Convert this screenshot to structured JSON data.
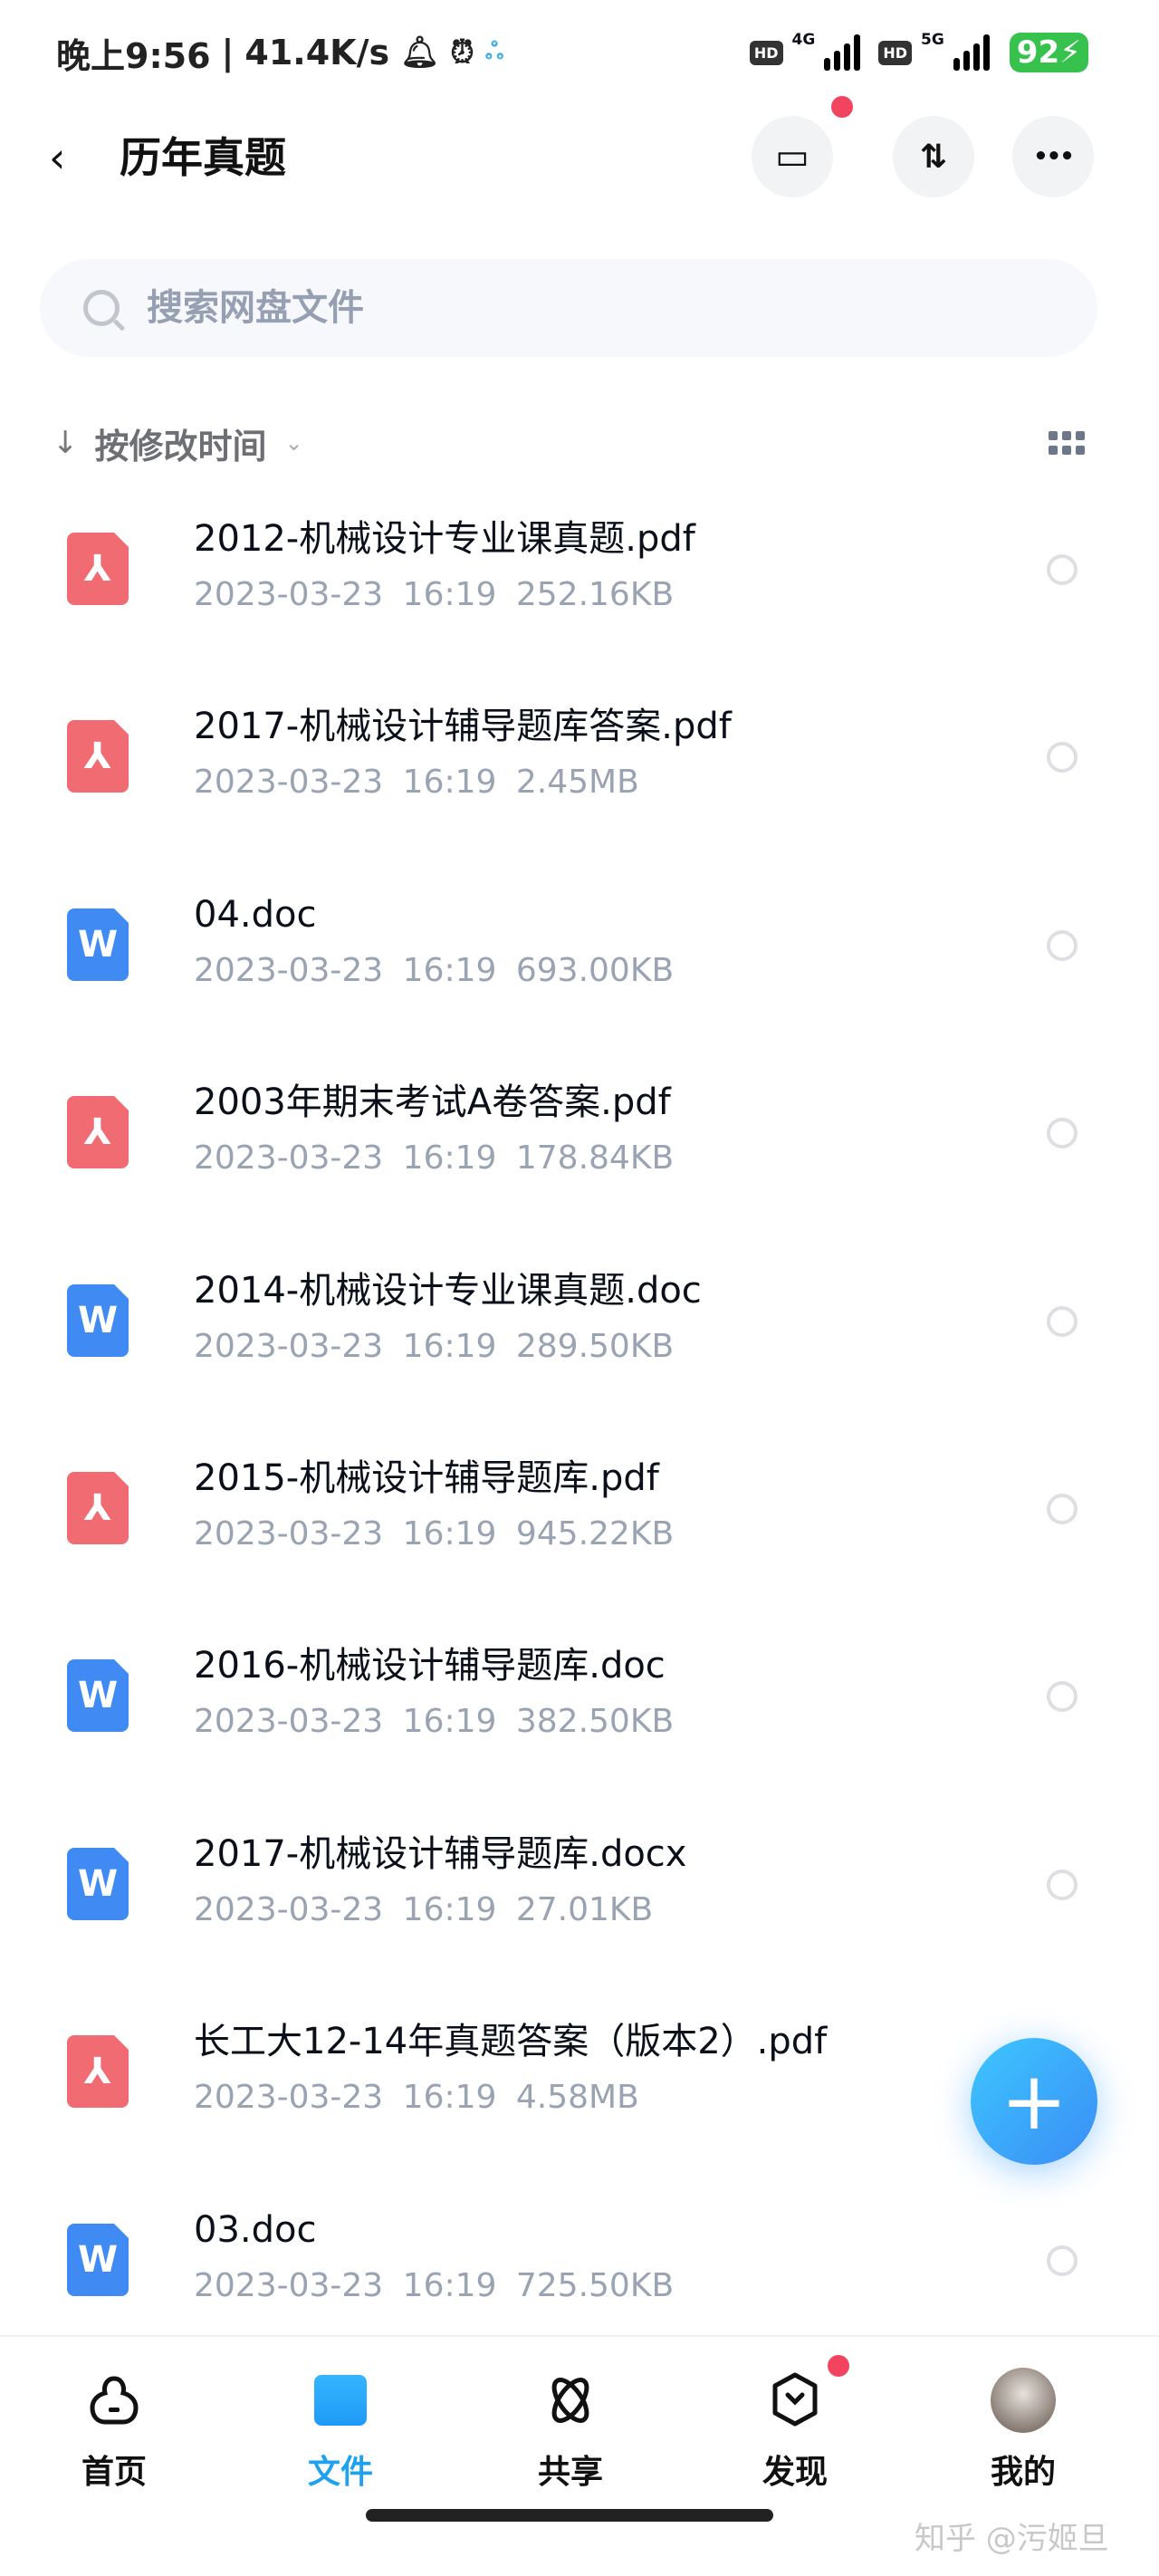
{
  "status_bar": {
    "time": "晚上9:56",
    "net_speed": "41.4K/s",
    "separator": "|",
    "sim1_hd": "HD",
    "sim1_net": "4G",
    "sim2_hd": "HD",
    "sim2_net": "5G",
    "battery": "92",
    "icons": [
      "bell-icon",
      "alarm-icon",
      "baidu-cloud-icon",
      "charging-icon"
    ]
  },
  "header": {
    "title": "历年真题",
    "back_icon": "chevron-left-icon",
    "buttons": [
      {
        "name": "transfer-list-button",
        "icon": "archive-icon",
        "glyph": "▭",
        "has_badge": true
      },
      {
        "name": "sort-toggle-button",
        "icon": "sort-arrows-icon",
        "glyph": "⇅",
        "has_badge": false
      },
      {
        "name": "more-button",
        "icon": "more-dots-icon",
        "glyph": "•••",
        "has_badge": false
      }
    ]
  },
  "search": {
    "placeholder": "搜索网盘文件",
    "value": ""
  },
  "sort": {
    "arrow": "↓",
    "label": "按修改时间",
    "chevron": "⌄"
  },
  "files": [
    {
      "name": "2012-机械设计专业课真题.pdf",
      "type": "pdf",
      "date": "2023-03-23",
      "time": "16:19",
      "size": "252.16KB"
    },
    {
      "name": "2017-机械设计辅导题库答案.pdf",
      "type": "pdf",
      "date": "2023-03-23",
      "time": "16:19",
      "size": "2.45MB"
    },
    {
      "name": "04.doc",
      "type": "doc",
      "date": "2023-03-23",
      "time": "16:19",
      "size": "693.00KB"
    },
    {
      "name": "2003年期末考试A卷答案.pdf",
      "type": "pdf",
      "date": "2023-03-23",
      "time": "16:19",
      "size": "178.84KB"
    },
    {
      "name": "2014-机械设计专业课真题.doc",
      "type": "doc",
      "date": "2023-03-23",
      "time": "16:19",
      "size": "289.50KB"
    },
    {
      "name": "2015-机械设计辅导题库.pdf",
      "type": "pdf",
      "date": "2023-03-23",
      "time": "16:19",
      "size": "945.22KB"
    },
    {
      "name": "2016-机械设计辅导题库.doc",
      "type": "doc",
      "date": "2023-03-23",
      "time": "16:19",
      "size": "382.50KB"
    },
    {
      "name": "2017-机械设计辅导题库.docx",
      "type": "doc",
      "date": "2023-03-23",
      "time": "16:19",
      "size": "27.01KB"
    },
    {
      "name": "长工大12-14年真题答案（版本2）.pdf",
      "type": "pdf",
      "date": "2023-03-23",
      "time": "16:19",
      "size": "4.58MB"
    },
    {
      "name": "03.doc",
      "type": "doc",
      "date": "2023-03-23",
      "time": "16:19",
      "size": "725.50KB"
    }
  ],
  "file_icon_glyphs": {
    "pdf": "⅄",
    "doc": "W"
  },
  "fab": {
    "glyph": "+"
  },
  "bottom_nav": [
    {
      "label": "首页",
      "icon": "home-cloud-icon",
      "active": false
    },
    {
      "label": "文件",
      "icon": "folder-icon",
      "active": true
    },
    {
      "label": "共享",
      "icon": "share-orbit-icon",
      "active": false
    },
    {
      "label": "发现",
      "icon": "discover-hexagon-icon",
      "active": false,
      "has_badge": true
    },
    {
      "label": "我的",
      "icon": "avatar",
      "active": false
    }
  ],
  "watermark": "知乎 @污姬旦",
  "colors": {
    "accent": "#1ea2f0",
    "badge": "#f2435f",
    "pdf": "#f06b72",
    "doc": "#3f8bf3",
    "battery": "#36c24d"
  }
}
